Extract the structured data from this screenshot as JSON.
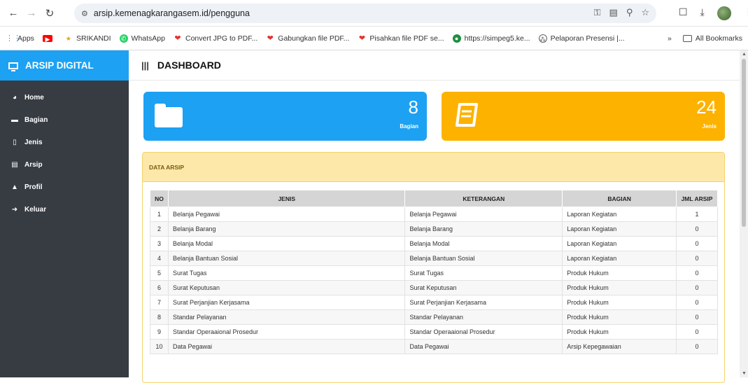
{
  "browser": {
    "url": "arsip.kemenagkarangasem.id/pengguna",
    "bookmarks": [
      {
        "label": "Apps",
        "icon": "apps-grid-icon",
        "color": "#4285f4"
      },
      {
        "label": "",
        "icon": "youtube-icon",
        "color": "#ff0000"
      },
      {
        "label": "SRIKANDI",
        "icon": "srikandi-icon",
        "color": "#e0a020"
      },
      {
        "label": "WhatsApp",
        "icon": "whatsapp-icon",
        "color": "#25d366"
      },
      {
        "label": "Convert JPG to PDF...",
        "icon": "ilovepdf-icon",
        "color": "#e5322d"
      },
      {
        "label": "Gabungkan file PDF...",
        "icon": "ilovepdf-icon",
        "color": "#e5322d"
      },
      {
        "label": "Pisahkan file PDF se...",
        "icon": "ilovepdf-icon",
        "color": "#e5322d"
      },
      {
        "label": "https://simpeg5.ke...",
        "icon": "simpeg-icon",
        "color": "#1e8e3e"
      },
      {
        "label": "Pelaporan Presensi |...",
        "icon": "presensi-icon",
        "color": "#5f6368"
      }
    ],
    "all_bookmarks_label": "All Bookmarks",
    "overflow_label": "»"
  },
  "sidebar": {
    "brand": "ARSIP DIGITAL",
    "items": [
      {
        "label": "Home",
        "icon": "dashboard-icon"
      },
      {
        "label": "Bagian",
        "icon": "folder-icon"
      },
      {
        "label": "Jenis",
        "icon": "book-icon"
      },
      {
        "label": "Arsip",
        "icon": "file-icon"
      },
      {
        "label": "Profil",
        "icon": "lock-icon"
      },
      {
        "label": "Keluar",
        "icon": "sign-out-icon"
      }
    ]
  },
  "header": {
    "title": "DASHBOARD"
  },
  "cards": [
    {
      "value": "8",
      "label": "Bagian",
      "color": "#1da1f2",
      "icon": "folder-icon"
    },
    {
      "value": "24",
      "label": "Jenis",
      "color": "#fdb200",
      "icon": "book-icon"
    }
  ],
  "panel": {
    "title": "DATA ARSIP",
    "columns": [
      "NO",
      "JENIS",
      "KETERANGAN",
      "BAGIAN",
      "JML ARSIP"
    ],
    "rows": [
      [
        "1",
        "Belanja Pegawai",
        "Belanja Pegawai",
        "Laporan Kegiatan",
        "1"
      ],
      [
        "2",
        "Belanja Barang",
        "Belanja Barang",
        "Laporan Kegiatan",
        "0"
      ],
      [
        "3",
        "Belanja Modal",
        "Belanja Modal",
        "Laporan Kegiatan",
        "0"
      ],
      [
        "4",
        "Belanja Bantuan Sosial",
        "Belanja Bantuan Sosial",
        "Laporan Kegiatan",
        "0"
      ],
      [
        "5",
        "Surat Tugas",
        "Surat Tugas",
        "Produk Hukum",
        "0"
      ],
      [
        "6",
        "Surat Keputusan",
        "Surat Keputusan",
        "Produk Hukum",
        "0"
      ],
      [
        "7",
        "Surat Perjanjian Kerjasama",
        "Surat Perjanjian Kerjasama",
        "Produk Hukum",
        "0"
      ],
      [
        "8",
        "Standar Pelayanan",
        "Standar Pelayanan",
        "Produk Hukum",
        "0"
      ],
      [
        "9",
        "Standar Operaaional Prosedur",
        "Standar Operaaional Prosedur",
        "Produk Hukum",
        "0"
      ],
      [
        "10",
        "Data Pegawai",
        "Data Pegawai",
        "Arsip Kepegawaian",
        "0"
      ]
    ]
  }
}
